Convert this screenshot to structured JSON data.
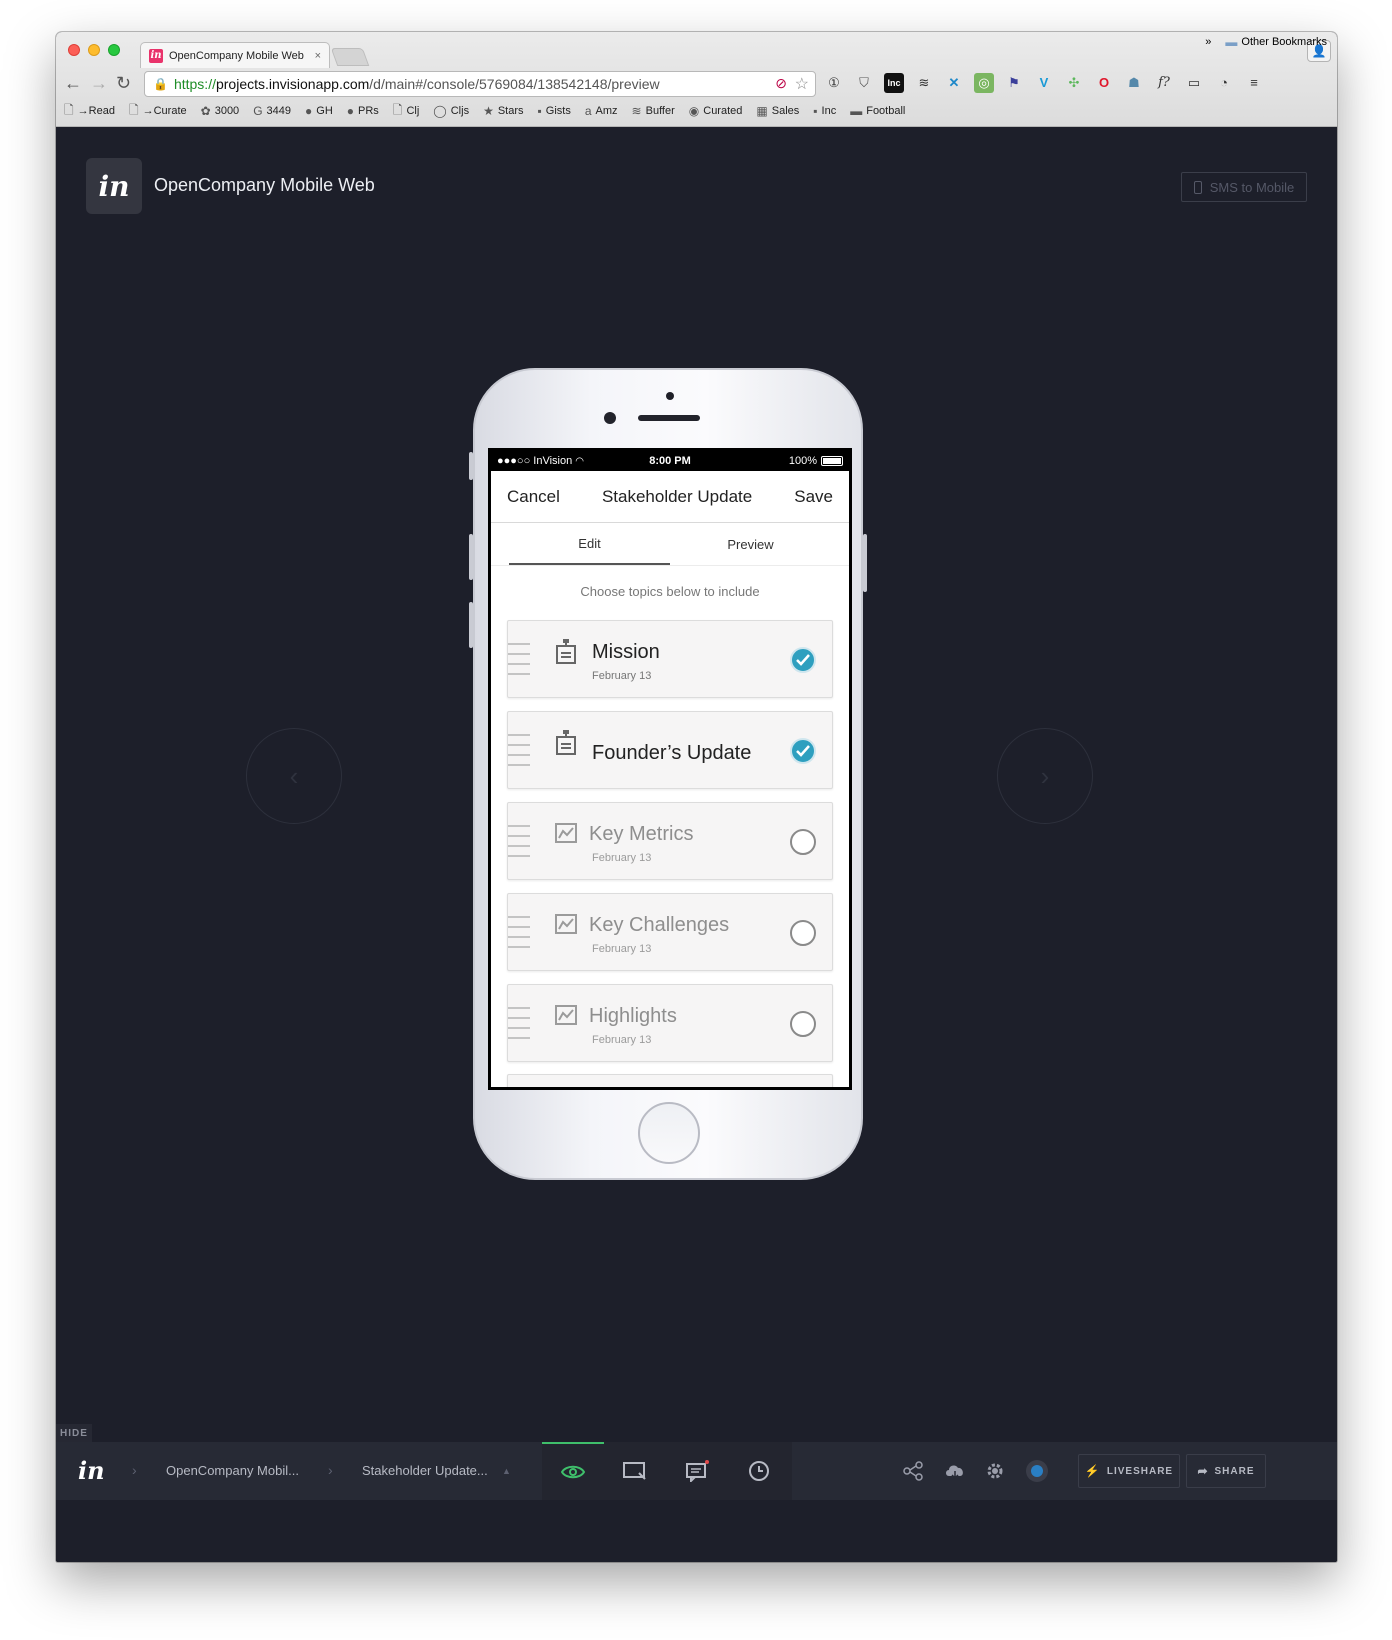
{
  "browser": {
    "tab_title": "OpenCompany Mobile Web",
    "tab_close": "×",
    "url_https": "https://",
    "url_host": "projects.invisionapp.com",
    "url_path": "/d/main#/console/5769084/138542148/preview",
    "bookmarks": [
      {
        "label": "→Read",
        "icon": "page-icon"
      },
      {
        "label": "→Curate",
        "icon": "page-icon"
      },
      {
        "label": "3000",
        "icon": "flower-icon"
      },
      {
        "label": "3449",
        "icon": "google-icon"
      },
      {
        "label": "GH",
        "icon": "github-icon"
      },
      {
        "label": "PRs",
        "icon": "github-icon"
      },
      {
        "label": "Clj",
        "icon": "page-icon"
      },
      {
        "label": "Cljs",
        "icon": "circle-icon"
      },
      {
        "label": "Stars",
        "icon": "star-icon"
      },
      {
        "label": "Gists",
        "icon": "gist-icon"
      },
      {
        "label": "Amz",
        "icon": "amazon-icon"
      },
      {
        "label": "Buffer",
        "icon": "buffer-icon"
      },
      {
        "label": "Curated",
        "icon": "curated-icon"
      },
      {
        "label": "Sales",
        "icon": "sheet-icon"
      },
      {
        "label": "Inc",
        "icon": "inc-icon"
      },
      {
        "label": "Football",
        "icon": "folder-icon"
      }
    ],
    "bookmarks_overflow": "»",
    "other_bookmarks": "Other Bookmarks"
  },
  "app": {
    "logo": "in",
    "project_title": "OpenCompany Mobile Web",
    "sms_button": "SMS to Mobile"
  },
  "phone": {
    "status": {
      "carrier": "●●●○○ InVision",
      "time": "8:00 PM",
      "battery": "100%"
    },
    "appbar": {
      "cancel": "Cancel",
      "title": "Stakeholder Update",
      "save": "Save"
    },
    "tabs": [
      {
        "label": "Edit",
        "active": true
      },
      {
        "label": "Preview",
        "active": false
      }
    ],
    "hint": "Choose topics below to include",
    "topics": [
      {
        "name": "Mission",
        "date": "February 13",
        "checked": true,
        "icon": "clipboard-icon"
      },
      {
        "name": "Founder’s Update",
        "date": "",
        "checked": true,
        "icon": "clipboard-icon"
      },
      {
        "name": "Key Metrics",
        "date": "February 13",
        "checked": false,
        "icon": "chart-icon"
      },
      {
        "name": "Key Challenges",
        "date": "February 13",
        "checked": false,
        "icon": "chart-icon"
      },
      {
        "name": "Highlights",
        "date": "February 13",
        "checked": false,
        "icon": "chart-icon"
      }
    ]
  },
  "toolbar": {
    "hide": "HIDE",
    "logo": "in",
    "crumb_project": "OpenCompany Mobil...",
    "crumb_screen": "Stakeholder Update...",
    "liveshare": "LIVESHARE",
    "share": "SHARE"
  },
  "colors": {
    "app_bg": "#1d1f2a",
    "check_accent": "#2e9fbf",
    "toolbar_active": "#3fbf6b"
  }
}
